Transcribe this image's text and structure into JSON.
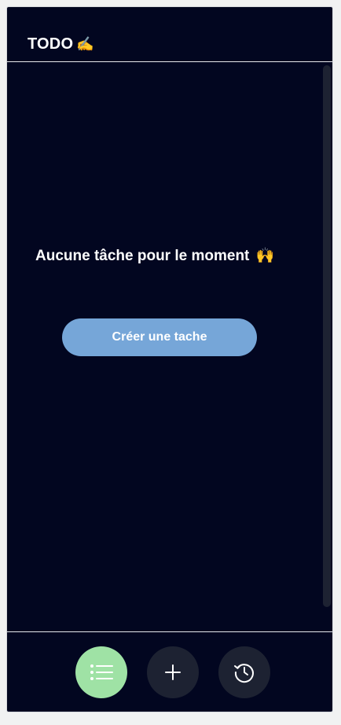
{
  "header": {
    "title": "TODO",
    "title_emoji": "✍️"
  },
  "main": {
    "empty_message": "Aucune tâche pour le moment",
    "empty_emoji": "🙌",
    "create_button_label": "Créer une tache"
  },
  "bottom_nav": {
    "items": [
      {
        "icon": "list-icon",
        "active": true
      },
      {
        "icon": "plus-icon",
        "active": false
      },
      {
        "icon": "clock-history-icon",
        "active": false
      }
    ]
  },
  "colors": {
    "background": "#020620",
    "button_primary": "#76a6d8",
    "nav_active": "#9fe2a5",
    "nav_inactive": "#1d2232"
  }
}
